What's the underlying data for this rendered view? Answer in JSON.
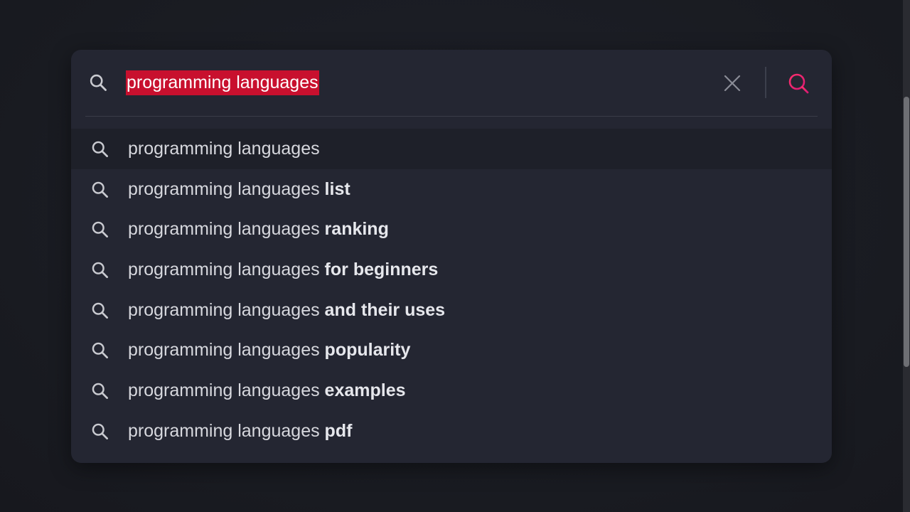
{
  "search": {
    "query": "programming languages",
    "lead_icon": "search-icon",
    "clear_icon": "close-icon",
    "submit_icon": "search-icon",
    "accent_color": "#e8336d",
    "highlight_color": "#c8102e"
  },
  "suggestions": [
    {
      "base": "programming languages",
      "completion": ""
    },
    {
      "base": "programming languages",
      "completion": " list"
    },
    {
      "base": "programming languages",
      "completion": " ranking"
    },
    {
      "base": "programming languages",
      "completion": " for beginners"
    },
    {
      "base": "programming languages",
      "completion": " and their uses"
    },
    {
      "base": "programming languages",
      "completion": " popularity"
    },
    {
      "base": "programming languages",
      "completion": " examples"
    },
    {
      "base": "programming languages",
      "completion": " pdf"
    }
  ]
}
